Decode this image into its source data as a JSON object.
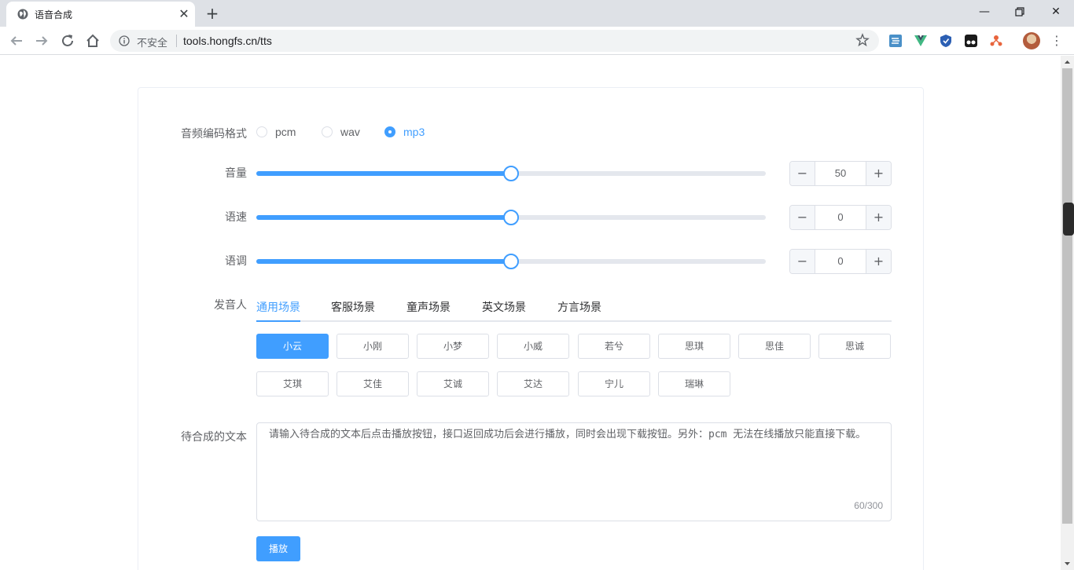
{
  "browser": {
    "tab_title": "语音合成",
    "security_label": "不安全",
    "url": "tools.hongfs.cn/tts"
  },
  "form": {
    "format": {
      "label": "音频编码格式",
      "options": [
        "pcm",
        "wav",
        "mp3"
      ],
      "selected": "mp3"
    },
    "volume": {
      "label": "音量",
      "value": "50",
      "slider_percent": 50
    },
    "speed": {
      "label": "语速",
      "value": "0",
      "slider_percent": 50
    },
    "pitch": {
      "label": "语调",
      "value": "0",
      "slider_percent": 50
    },
    "speaker": {
      "label": "发音人",
      "tabs": [
        "通用场景",
        "客服场景",
        "童声场景",
        "英文场景",
        "方言场景"
      ],
      "active_tab": "通用场景",
      "voices_row1": [
        "小云",
        "小刚",
        "小梦",
        "小威",
        "若兮",
        "思琪",
        "思佳",
        "思诚"
      ],
      "voices_row2": [
        "艾琪",
        "艾佳",
        "艾诚",
        "艾达",
        "宁儿",
        "瑞琳"
      ],
      "active_voice": "小云"
    },
    "text": {
      "label": "待合成的文本",
      "value": "请输入待合成的文本后点击播放按钮，接口返回成功后会进行播放，同时会出现下载按钮。另外：pcm 无法在线播放只能直接下载。",
      "counter": "60/300"
    },
    "play_label": "播放"
  },
  "colors": {
    "primary": "#409eff",
    "track": "#e4e7ed",
    "border": "#dcdfe6"
  }
}
